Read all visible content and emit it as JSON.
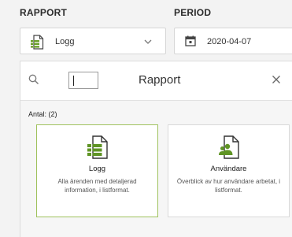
{
  "labels": {
    "rapport": "RAPPORT",
    "period": "PERIOD"
  },
  "report_select": {
    "value": "Logg",
    "icon": "list-document-icon"
  },
  "period_select": {
    "value": "2020-04-07",
    "icon": "calendar-icon"
  },
  "panel": {
    "title": "Rapport",
    "search_value": "",
    "count_label": "Antal: (2)",
    "cards": [
      {
        "title": "Logg",
        "description": "Alla ärenden med detaljerad information, i listformat.",
        "icon": "list-document-icon",
        "selected": true
      },
      {
        "title": "Användare",
        "description": "Överblick av hur användare arbetat, i listformat.",
        "icon": "users-document-icon",
        "selected": false
      }
    ]
  },
  "colors": {
    "accent_green": "#6a9e2a",
    "selected_border": "#9fc25d"
  }
}
